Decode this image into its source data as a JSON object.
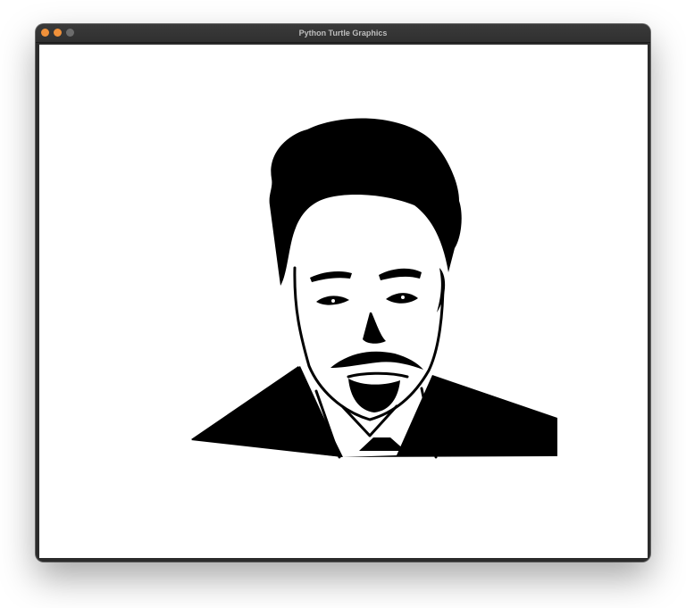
{
  "window": {
    "title": "Python Turtle Graphics",
    "controls": [
      "close-icon",
      "minimize-icon",
      "zoom-icon"
    ]
  },
  "canvas": {
    "background": "#ffffff",
    "ink_color": "#000000",
    "drawing": "portrait"
  },
  "colors": {
    "titlebar": "#333333",
    "traffic_light_active": "#f0913a",
    "traffic_light_inactive": "#6c6c6c"
  }
}
